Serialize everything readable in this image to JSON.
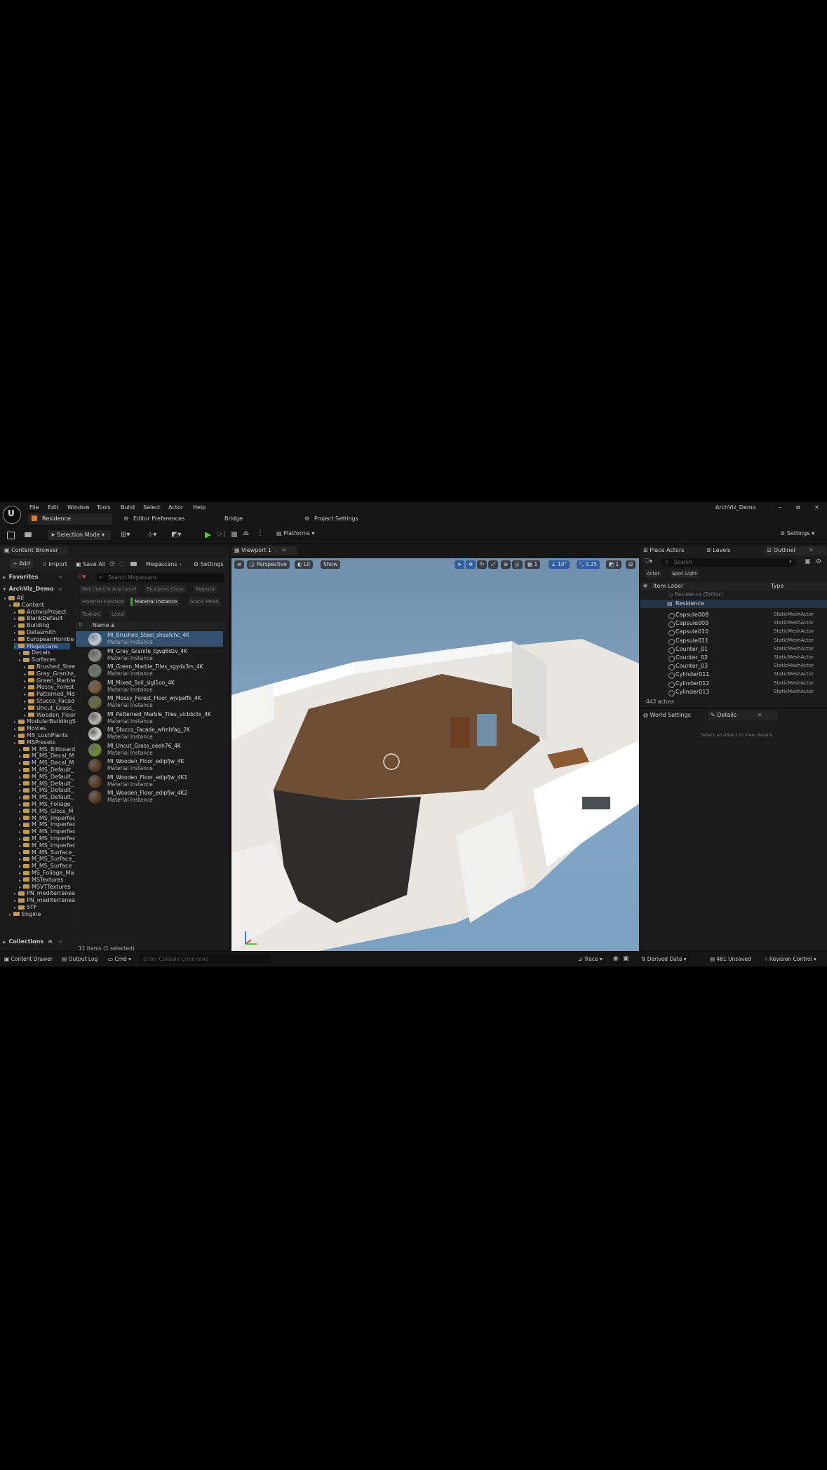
{
  "menu": [
    "File",
    "Edit",
    "Window",
    "Tools",
    "Build",
    "Select",
    "Actor",
    "Help"
  ],
  "project_name": "ArchViz_Demo",
  "window_controls": {
    "minimize": "–",
    "restore": "⧉",
    "close": "✕"
  },
  "tabs": {
    "level": "Residence",
    "editor_prefs": "Editor Preferences",
    "bridge": "Bridge",
    "project_settings": "Project Settings"
  },
  "toolbar": {
    "selection_mode": "Selection Mode",
    "platforms": "Platforms",
    "settings": "Settings"
  },
  "content_browser": {
    "tab": "Content Browser",
    "add": "Add",
    "import": "Import",
    "save_all": "Save All",
    "path": "Megascans",
    "settings": "Settings",
    "favorites": "Favorites",
    "root": "ArchViz_Demo",
    "search_placeholder": "Search Megascans",
    "filters": [
      "Not Used In Any Level",
      "Blueprint Class",
      "Material",
      "Material Function",
      "Material Instance",
      "Static Mesh",
      "Texture",
      "Level"
    ],
    "column_name": "Name",
    "tree": [
      {
        "label": "All",
        "indent": 0
      },
      {
        "label": "Content",
        "indent": 1
      },
      {
        "label": "ArchvisProject",
        "indent": 2
      },
      {
        "label": "BlankDefault",
        "indent": 2
      },
      {
        "label": "Building",
        "indent": 2
      },
      {
        "label": "Datasmith",
        "indent": 2
      },
      {
        "label": "EuropeanHornbe",
        "indent": 2
      },
      {
        "label": "Megascans",
        "indent": 2
      },
      {
        "label": "Decals",
        "indent": 3
      },
      {
        "label": "Surfaces",
        "indent": 3
      },
      {
        "label": "Brushed_Stee",
        "indent": 4
      },
      {
        "label": "Gray_Granite_",
        "indent": 4
      },
      {
        "label": "Green_Marble",
        "indent": 4
      },
      {
        "label": "Mossy_Forest",
        "indent": 4
      },
      {
        "label": "Patterned_Ma",
        "indent": 4
      },
      {
        "label": "Stucco_Facad",
        "indent": 4
      },
      {
        "label": "Uncut_Grass_",
        "indent": 4
      },
      {
        "label": "Wooden_Floor",
        "indent": 4
      },
      {
        "label": "ModularBuildingS",
        "indent": 2
      },
      {
        "label": "Movies",
        "indent": 2
      },
      {
        "label": "MS_LushPlants",
        "indent": 2
      },
      {
        "label": "MSPresets",
        "indent": 2
      },
      {
        "label": "M_MS_Billboard",
        "indent": 3
      },
      {
        "label": "M_MS_Decal_M",
        "indent": 3
      },
      {
        "label": "M_MS_Decal_M",
        "indent": 3
      },
      {
        "label": "M_MS_Default_",
        "indent": 3
      },
      {
        "label": "M_MS_Default_",
        "indent": 3
      },
      {
        "label": "M_MS_Default_",
        "indent": 3
      },
      {
        "label": "M_MS_Default_",
        "indent": 3
      },
      {
        "label": "M_MS_Default_",
        "indent": 3
      },
      {
        "label": "M_MS_Foliage_",
        "indent": 3
      },
      {
        "label": "M_MS_Gloss_M",
        "indent": 3
      },
      {
        "label": "M_MS_Imperfec",
        "indent": 3
      },
      {
        "label": "M_MS_Imperfec",
        "indent": 3
      },
      {
        "label": "M_MS_Imperfec",
        "indent": 3
      },
      {
        "label": "M_MS_Imperfec",
        "indent": 3
      },
      {
        "label": "M_MS_Imperfec",
        "indent": 3
      },
      {
        "label": "M_MS_Surface_",
        "indent": 3
      },
      {
        "label": "M_MS_Surface_",
        "indent": 3
      },
      {
        "label": "M_MS_Surface",
        "indent": 3
      },
      {
        "label": "MS_Foliage_Ma",
        "indent": 3
      },
      {
        "label": "MSTextures",
        "indent": 3
      },
      {
        "label": "MSVTTextures",
        "indent": 3
      },
      {
        "label": "PN_mediterranea",
        "indent": 2
      },
      {
        "label": "PN_mediterranea",
        "indent": 2
      },
      {
        "label": "STF",
        "indent": 2
      },
      {
        "label": "Engine",
        "indent": 1
      }
    ],
    "assets": [
      {
        "name": "MI_Brushed_Steel_sheafchc_4K",
        "type": "Material Instance",
        "color": "#c8ccd2"
      },
      {
        "name": "MI_Gray_Granite_tgvg6dzv_4K",
        "type": "Material Instance",
        "color": "#8d8d8d"
      },
      {
        "name": "MI_Green_Marble_Tiles_sgydx3rs_4K",
        "type": "Material Instance",
        "color": "#6e7a72"
      },
      {
        "name": "MI_Mixed_Soil_slgl1oo_4K",
        "type": "Material Instance",
        "color": "#7b5a36"
      },
      {
        "name": "MI_Mossy_Forest_Floor_wjvpaffk_4K",
        "type": "Material Instance",
        "color": "#6c6a3e"
      },
      {
        "name": "MI_Patterned_Marble_Tiles_vicbbctx_4K",
        "type": "Material Instance",
        "color": "#b9b5ac"
      },
      {
        "name": "MI_Stucco_Facade_wfmhfag_2K",
        "type": "Material Instance",
        "color": "#d6d6d2"
      },
      {
        "name": "MI_Uncut_Grass_oeeh76_4K",
        "type": "Material Instance",
        "color": "#6d8b35"
      },
      {
        "name": "MI_Wooden_Floor_edipfjw_4K",
        "type": "Material Instance",
        "color": "#5a3a22"
      },
      {
        "name": "MI_Wooden_Floor_edipfjw_4K1",
        "type": "Material Instance",
        "color": "#5a3a22"
      },
      {
        "name": "MI_Wooden_Floor_edipfjw_4K2",
        "type": "Material Instance",
        "color": "#5a3a22"
      }
    ],
    "collections": "Collections",
    "item_count": "11 items (1 selected)"
  },
  "viewport": {
    "tab": "Viewport 1",
    "perspective": "Perspective",
    "lit": "Lit",
    "show": "Show",
    "grid": "1",
    "angle": "10°",
    "scale": "0.25",
    "speed": "1"
  },
  "right_tabs": {
    "place_actors": "Place Actors",
    "levels": "Levels",
    "outliner": "Outliner"
  },
  "outliner": {
    "search_placeholder": "Search",
    "filter_actor": "Actor",
    "filter_spot_light": "Spot Light",
    "col_label": "Item Label",
    "col_type": "Type",
    "world": "Residence (Editor)",
    "level": "Residence",
    "rows": [
      {
        "name": "Capsule008",
        "type": "StaticMeshActor"
      },
      {
        "name": "Capsule009",
        "type": "StaticMeshActor"
      },
      {
        "name": "Capsule010",
        "type": "StaticMeshActor"
      },
      {
        "name": "Capsule011",
        "type": "StaticMeshActor"
      },
      {
        "name": "Counter_01",
        "type": "StaticMeshActor"
      },
      {
        "name": "Counter_02",
        "type": "StaticMeshActor"
      },
      {
        "name": "Counter_03",
        "type": "StaticMeshActor"
      },
      {
        "name": "Cylinder011",
        "type": "StaticMeshActor"
      },
      {
        "name": "Cylinder012",
        "type": "StaticMeshActor"
      },
      {
        "name": "Cylinder013",
        "type": "StaticMeshActor"
      }
    ],
    "actor_count": "443 actors"
  },
  "details": {
    "world_settings": "World Settings",
    "details": "Details",
    "empty": "Select an object to view details."
  },
  "status": {
    "content_drawer": "Content Drawer",
    "output_log": "Output Log",
    "cmd": "Cmd",
    "console_placeholder": "Enter Console Command",
    "trace": "Trace",
    "derived_data": "Derived Data",
    "unsaved": "461 Unsaved",
    "revision": "Revision Control"
  }
}
